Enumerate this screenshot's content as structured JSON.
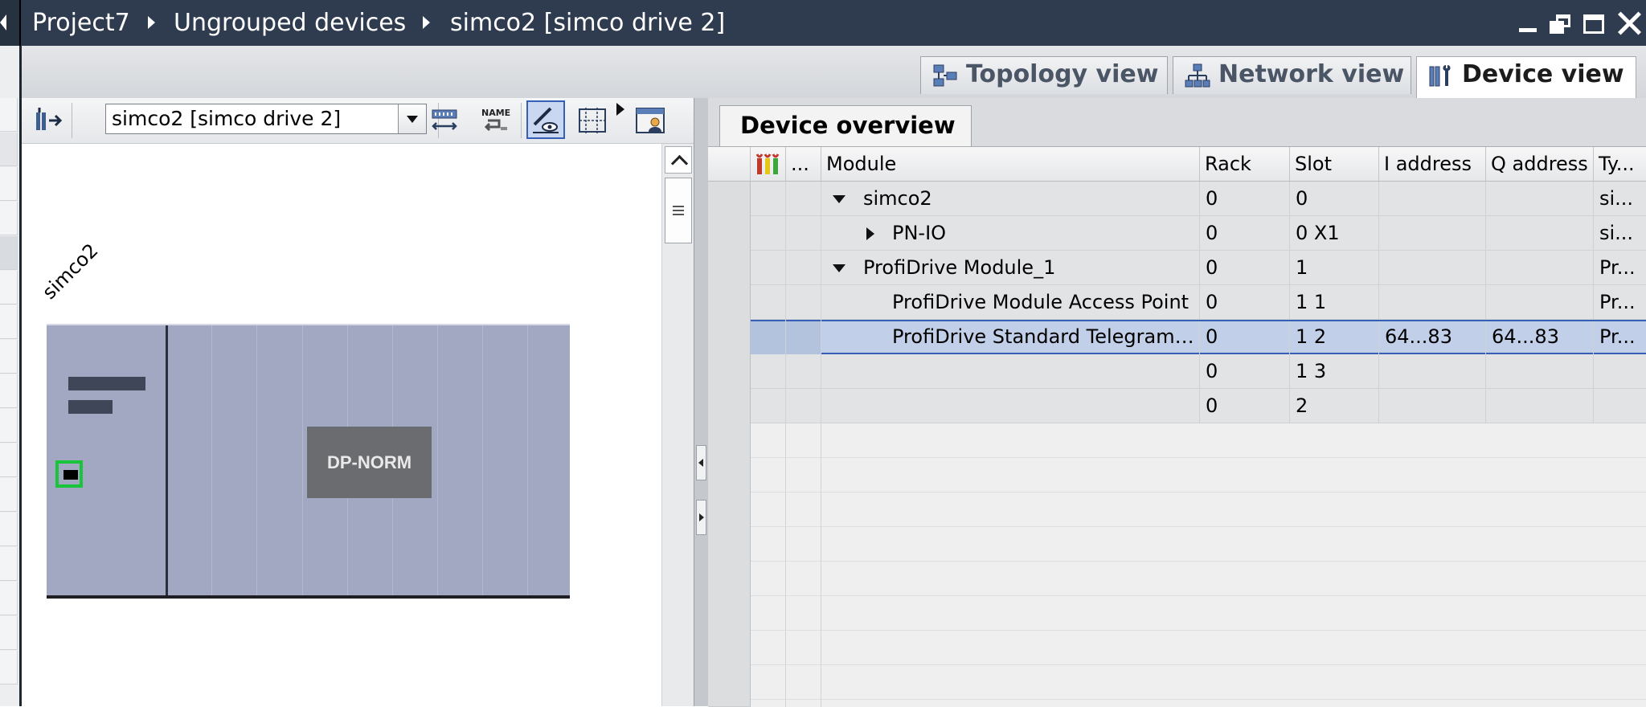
{
  "breadcrumb": {
    "items": [
      "Project7",
      "Ungrouped devices",
      "simco2 [simco drive 2]"
    ]
  },
  "window_controls": [
    "minimize",
    "restore",
    "maximize",
    "close"
  ],
  "view_tabs": [
    {
      "label": "Topology view",
      "icon": "topology-icon",
      "active": false
    },
    {
      "label": "Network view",
      "icon": "network-icon",
      "active": false
    },
    {
      "label": "Device view",
      "icon": "device-view-icon",
      "active": true
    }
  ],
  "graphic_view": {
    "device_selector_value": "simco2 [simco drive 2]",
    "device_name": "simco2",
    "module_label": "DP-NORM"
  },
  "device_overview": {
    "tab_label": "Device overview",
    "columns": [
      "...",
      "Module",
      "Rack",
      "Slot",
      "I address",
      "Q address",
      "Ty..."
    ],
    "rows": [
      {
        "module": "simco2",
        "expander": "expanded",
        "indent": 0,
        "rack": "0",
        "slot": "0",
        "i_address": "",
        "q_address": "",
        "type": "si..."
      },
      {
        "module": "PN-IO",
        "expander": "collapsed",
        "indent": 1,
        "rack": "0",
        "slot": "0 X1",
        "i_address": "",
        "q_address": "",
        "type": "si..."
      },
      {
        "module": "ProfiDrive Module_1",
        "expander": "expanded",
        "indent": 0,
        "rack": "0",
        "slot": "1",
        "i_address": "",
        "q_address": "",
        "type": "Pr..."
      },
      {
        "module": "ProfiDrive Module Access Point",
        "expander": "none",
        "indent": 1,
        "rack": "0",
        "slot": "1 1",
        "i_address": "",
        "q_address": "",
        "type": "Pr..."
      },
      {
        "module": "ProfiDrive Standard Telegram ...",
        "expander": "none",
        "indent": 1,
        "rack": "0",
        "slot": "1 2",
        "i_address": "64...83",
        "q_address": "64...83",
        "type": "Pr...",
        "selected": true
      },
      {
        "module": "",
        "expander": "none",
        "indent": 0,
        "rack": "0",
        "slot": "1 3",
        "i_address": "",
        "q_address": "",
        "type": ""
      },
      {
        "module": "",
        "expander": "none",
        "indent": 0,
        "rack": "0",
        "slot": "2",
        "i_address": "",
        "q_address": "",
        "type": ""
      }
    ]
  },
  "colors": {
    "titlebar_bg": "#2f3c50",
    "rack_fill": "#a2a8c1",
    "port_highlight": "#18c43a",
    "selected_row": "#c1cfe9",
    "selection_border": "#3560b5"
  }
}
